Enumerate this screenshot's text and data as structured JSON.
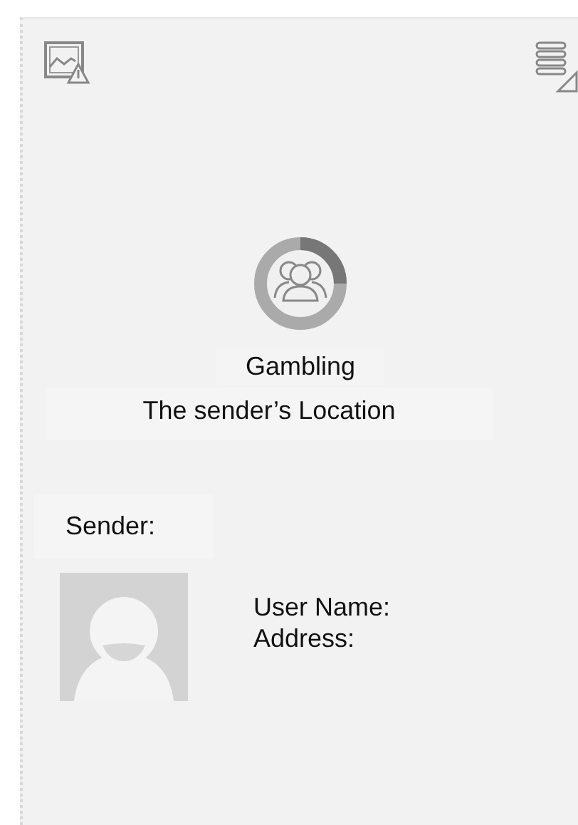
{
  "category": {
    "title": "Gambling",
    "subtitle": "The sender’s Location"
  },
  "sender": {
    "label": "Sender:",
    "fields": [
      "User Name:",
      "Address:"
    ]
  }
}
